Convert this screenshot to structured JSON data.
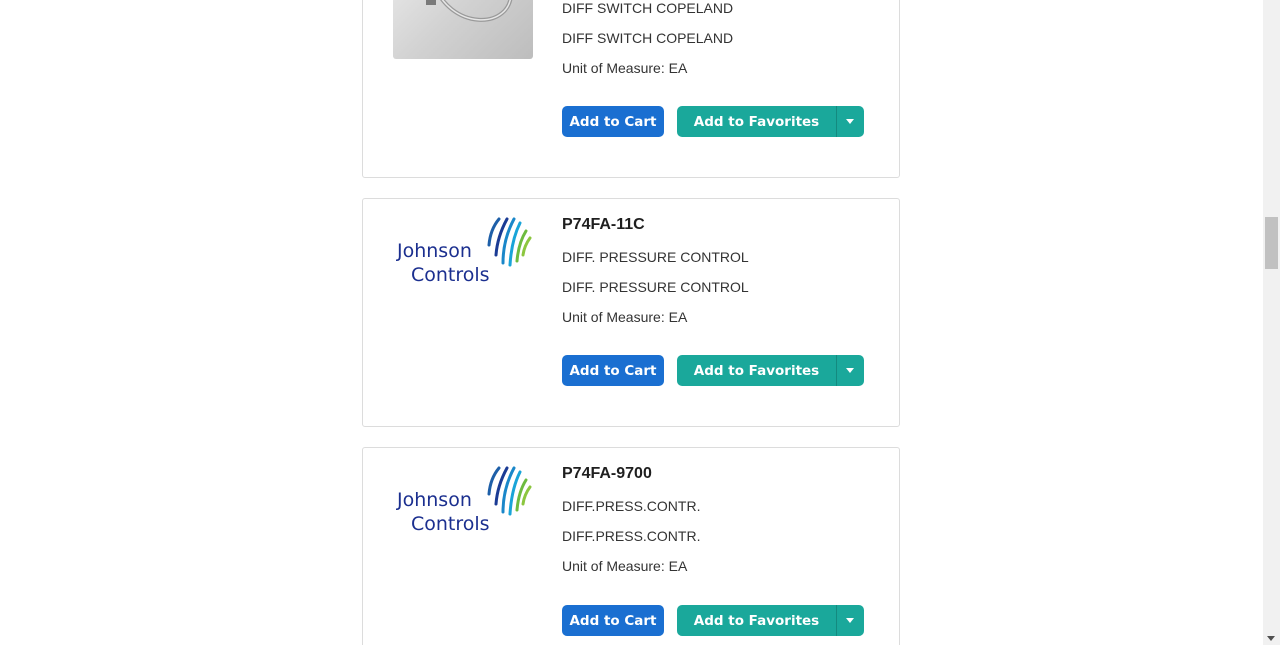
{
  "products": [
    {
      "part_number": "",
      "description_1": "DIFF SWITCH COPELAND",
      "description_2": "DIFF SWITCH COPELAND",
      "unit_of_measure": "Unit of Measure: EA",
      "image": "pressure-switch-photo",
      "add_to_cart_label": "Add to Cart",
      "add_to_favorites_label": "Add to Favorites"
    },
    {
      "part_number": "P74FA-11C",
      "description_1": "DIFF. PRESSURE CONTROL",
      "description_2": "DIFF. PRESSURE CONTROL",
      "unit_of_measure": "Unit of Measure: EA",
      "image": "johnson-controls-logo",
      "logo_text_1": "Johnson",
      "logo_text_2": "Controls",
      "add_to_cart_label": "Add to Cart",
      "add_to_favorites_label": "Add to Favorites"
    },
    {
      "part_number": "P74FA-9700",
      "description_1": "DIFF.PRESS.CONTR.",
      "description_2": "DIFF.PRESS.CONTR.",
      "unit_of_measure": "Unit of Measure: EA",
      "image": "johnson-controls-logo",
      "logo_text_1": "Johnson",
      "logo_text_2": "Controls",
      "add_to_cart_label": "Add to Cart",
      "add_to_favorites_label": "Add to Favorites"
    }
  ],
  "colors": {
    "cart_button": "#1a6fd1",
    "favorites_button": "#1aa89b",
    "logo_navy": "#1b2f8f"
  }
}
